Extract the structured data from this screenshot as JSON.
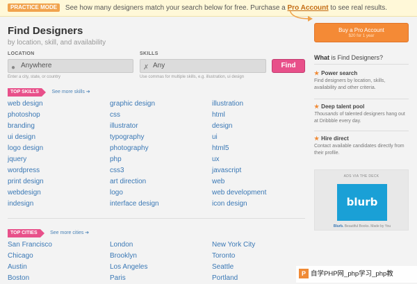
{
  "banner": {
    "mode": "PRACTICE MODE",
    "text": "See how many designers match your search below for free. Purchase a",
    "link": "Pro Account",
    "suffix": "to see real results."
  },
  "header": {
    "title": "Find Designers",
    "subtitle": "by location, skill, and availability"
  },
  "search": {
    "location_label": "LOCATION",
    "location_value": "Anywhere",
    "location_hint": "Enter a city, state, or country",
    "skills_label": "SKILLS",
    "skills_value": "Any",
    "skills_hint": "Use commas for multiple skills, e.g. illustration, ui design",
    "find_button": "Find"
  },
  "top_skills": {
    "tag": "TOP SKILLS",
    "see_more": "See more skills ➔",
    "columns": [
      [
        "web design",
        "photoshop",
        "branding",
        "ui design",
        "logo design",
        "jquery",
        "wordpress",
        "print design",
        "webdesign",
        "indesign"
      ],
      [
        "graphic design",
        "css",
        "illustrator",
        "typography",
        "photography",
        "php",
        "css3",
        "art direction",
        "logo",
        "interface design"
      ],
      [
        "illustration",
        "html",
        "design",
        "ui",
        "html5",
        "ux",
        "javascript",
        "web",
        "web development",
        "icon design"
      ]
    ]
  },
  "top_cities": {
    "tag": "TOP CITIES",
    "see_more": "See more cities ➔",
    "columns": [
      [
        "San Francisco",
        "Chicago",
        "Austin",
        "Boston"
      ],
      [
        "London",
        "Brooklyn",
        "Los Angeles",
        "Paris"
      ],
      [
        "New York City",
        "Toronto",
        "Seattle",
        "Portland"
      ]
    ]
  },
  "sidebar": {
    "buy_label": "Buy a Pro Account",
    "buy_price": "$20 for 1 year",
    "what_title_bold": "What",
    "what_title_rest": "is Find Designers?",
    "features": [
      {
        "title": "Power search",
        "desc": "Find designers by location, skills, availability and other criteria."
      },
      {
        "title": "Deep talent pool",
        "desc_italic": "Thousands",
        "desc": "of talented designers hang out at Dribbble every day."
      },
      {
        "title": "Hire direct",
        "desc": "Contact available candidates directly from their profile."
      }
    ],
    "ad": {
      "header": "ADS VIA THE DECK",
      "logo": "blurb",
      "caption_bold": "Blurb.",
      "caption": "Beautiful Books. Made by You"
    }
  },
  "watermark": {
    "logo": "P",
    "text": "自学PHP网_php学习_php教"
  },
  "colors": {
    "accent_pink": "#e8508a",
    "accent_orange": "#f48a36",
    "link_blue": "#3a78b5",
    "ad_blue": "#1aa0d6"
  }
}
